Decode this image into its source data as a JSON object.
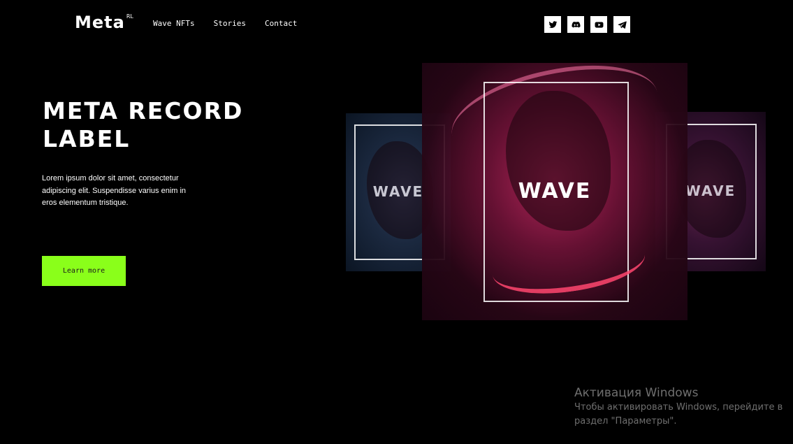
{
  "header": {
    "logo": "Meta",
    "logo_sup": "RL",
    "nav": [
      "Wave NFTs",
      "Stories",
      "Contact"
    ],
    "socials": [
      "twitter-icon",
      "discord-icon",
      "youtube-icon",
      "telegram-icon"
    ]
  },
  "hero": {
    "title_line1": "META RECORD",
    "title_line2": "LABEL",
    "description": "Lorem ipsum dolor sit amet, consectetur adipiscing elit. Suspendisse varius enim in eros elementum tristique.",
    "cta_label": "Learn more"
  },
  "posters": {
    "left_word": "WAVE",
    "main_word": "WAVE",
    "right_word": "WAVE"
  },
  "watermark": {
    "title": "Активация Windows",
    "line1": "Чтобы активировать Windows, перейдите в",
    "line2": "раздел \"Параметры\"."
  },
  "colors": {
    "background": "#000000",
    "cta_accent": "#8aff1a",
    "poster_main": "#be285f"
  }
}
